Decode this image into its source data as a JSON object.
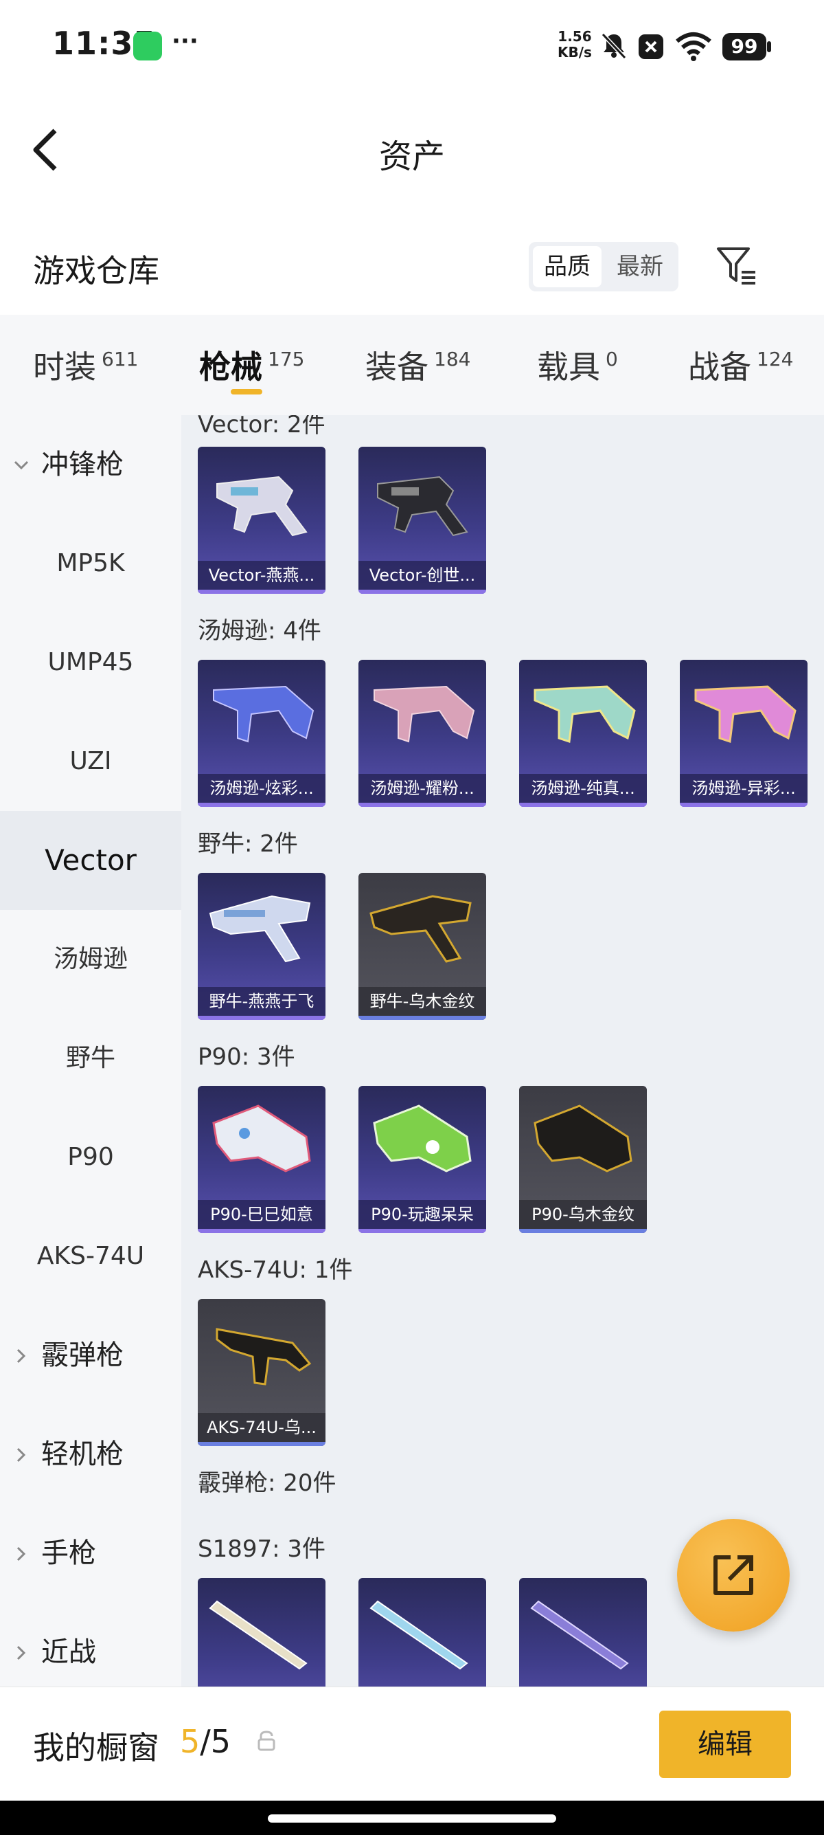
{
  "status_bar": {
    "time": "11:35",
    "speed_value": "1.56",
    "speed_unit": "KB/s",
    "battery": "99"
  },
  "header": {
    "title": "资产"
  },
  "warehouse": {
    "title": "游戏仓库",
    "sort_options": [
      "品质",
      "最新"
    ],
    "active_sort": "品质"
  },
  "tabs": [
    {
      "label": "时装",
      "count": "611"
    },
    {
      "label": "枪械",
      "count": "175",
      "active": true
    },
    {
      "label": "装备",
      "count": "184"
    },
    {
      "label": "载具",
      "count": "0"
    },
    {
      "label": "战备",
      "count": "124"
    }
  ],
  "sidebar": {
    "items": [
      {
        "label": "冲锋枪",
        "type": "group-expanded"
      },
      {
        "label": "MP5K"
      },
      {
        "label": "UMP45"
      },
      {
        "label": "UZI"
      },
      {
        "label": "Vector",
        "selected": true
      },
      {
        "label": "汤姆逊"
      },
      {
        "label": "野牛"
      },
      {
        "label": "P90"
      },
      {
        "label": "AKS-74U"
      },
      {
        "label": "霰弹枪",
        "type": "group"
      },
      {
        "label": "轻机枪",
        "type": "group"
      },
      {
        "label": "手枪",
        "type": "group"
      },
      {
        "label": "近战",
        "type": "group"
      }
    ]
  },
  "content": {
    "groups": [
      {
        "title": "Vector: 2件",
        "items": [
          "Vector-燕燕...",
          "Vector-创世..."
        ]
      },
      {
        "title": "汤姆逊: 4件",
        "items": [
          "汤姆逊-炫彩...",
          "汤姆逊-耀粉...",
          "汤姆逊-纯真...",
          "汤姆逊-异彩..."
        ]
      },
      {
        "title": "野牛: 2件",
        "items": [
          "野牛-燕燕于飞",
          "野牛-乌木金纹"
        ]
      },
      {
        "title": "P90: 3件",
        "items": [
          "P90-巳巳如意",
          "P90-玩趣呆呆",
          "P90-乌木金纹"
        ]
      },
      {
        "title": "AKS-74U: 1件",
        "items": [
          "AKS-74U-乌..."
        ]
      },
      {
        "title": "霰弹枪: 20件",
        "items": []
      },
      {
        "title": "S1897: 3件",
        "items": [
          "",
          "",
          ""
        ]
      }
    ]
  },
  "bottom": {
    "showcase_label": "我的橱窗",
    "showcase_current": "5",
    "showcase_total": "/5",
    "edit_label": "编辑"
  },
  "colors": {
    "accent": "#f0b429",
    "card_purple": "#3e3c88",
    "card_grey": "#55555e"
  }
}
